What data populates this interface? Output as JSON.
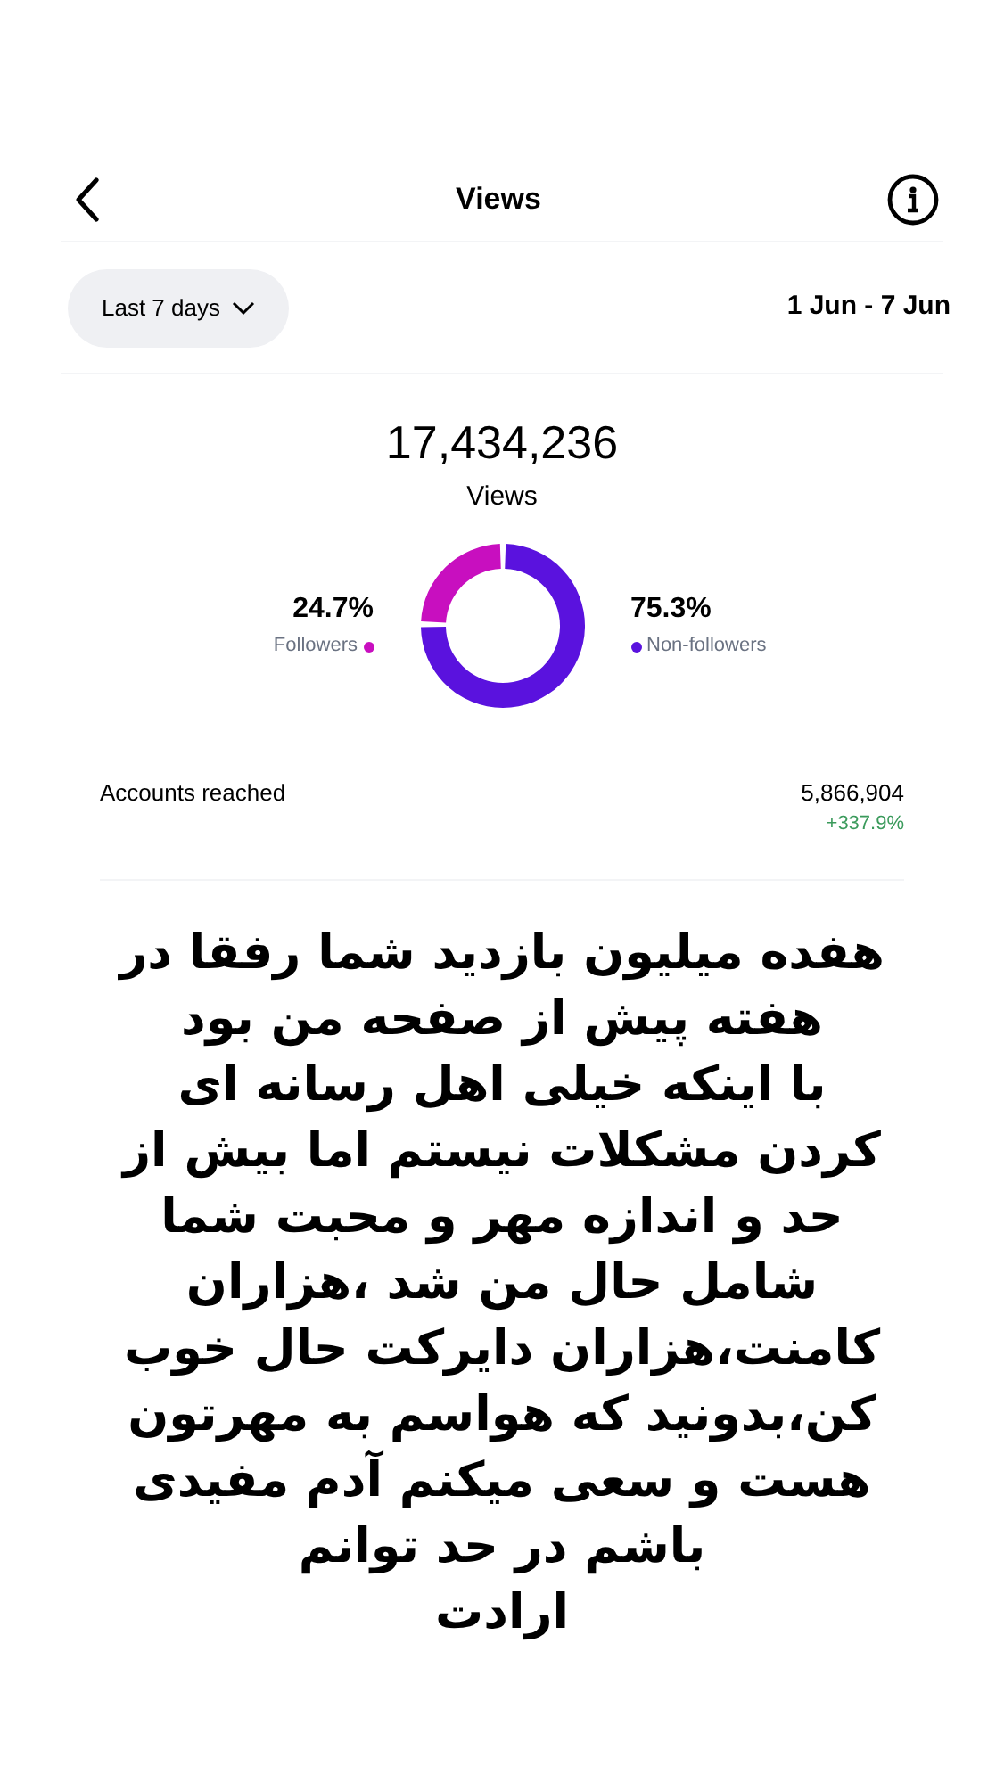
{
  "header": {
    "title": "Views"
  },
  "filter": {
    "label": "Last 7 days",
    "date_range": "1 Jun - 7 Jun"
  },
  "summary": {
    "value": "17,434,236",
    "label": "Views"
  },
  "chart_data": {
    "type": "donut",
    "categories": [
      "Followers",
      "Non-followers"
    ],
    "values": [
      24.7,
      75.3
    ],
    "value_labels": [
      "24.7%",
      "75.3%"
    ]
  },
  "legend": [
    {
      "color": "#c80fbf"
    },
    {
      "color": "#5a12de"
    }
  ],
  "metrics": [
    {
      "label": "Accounts reached",
      "value": "5,866,904",
      "change": "+337.9%"
    }
  ],
  "caption_lines": [
    "هفده میلیون بازدید شما رفقا در",
    "هفته پیش از صفحه من بود",
    "با اینکه خیلی اهل رسانه ای",
    "کردن مشکلات نیستم اما بیش از",
    "حد و اندازه مهر و محبت شما",
    "شامل حال من شد ،هزاران",
    "کامنت،هزاران دایرکت حال خوب",
    "کن،بدونید که هواسم به مهرتون",
    "هست و سعی میکنم آدم مفیدی",
    "باشم در حد توانم",
    "ارادت"
  ]
}
